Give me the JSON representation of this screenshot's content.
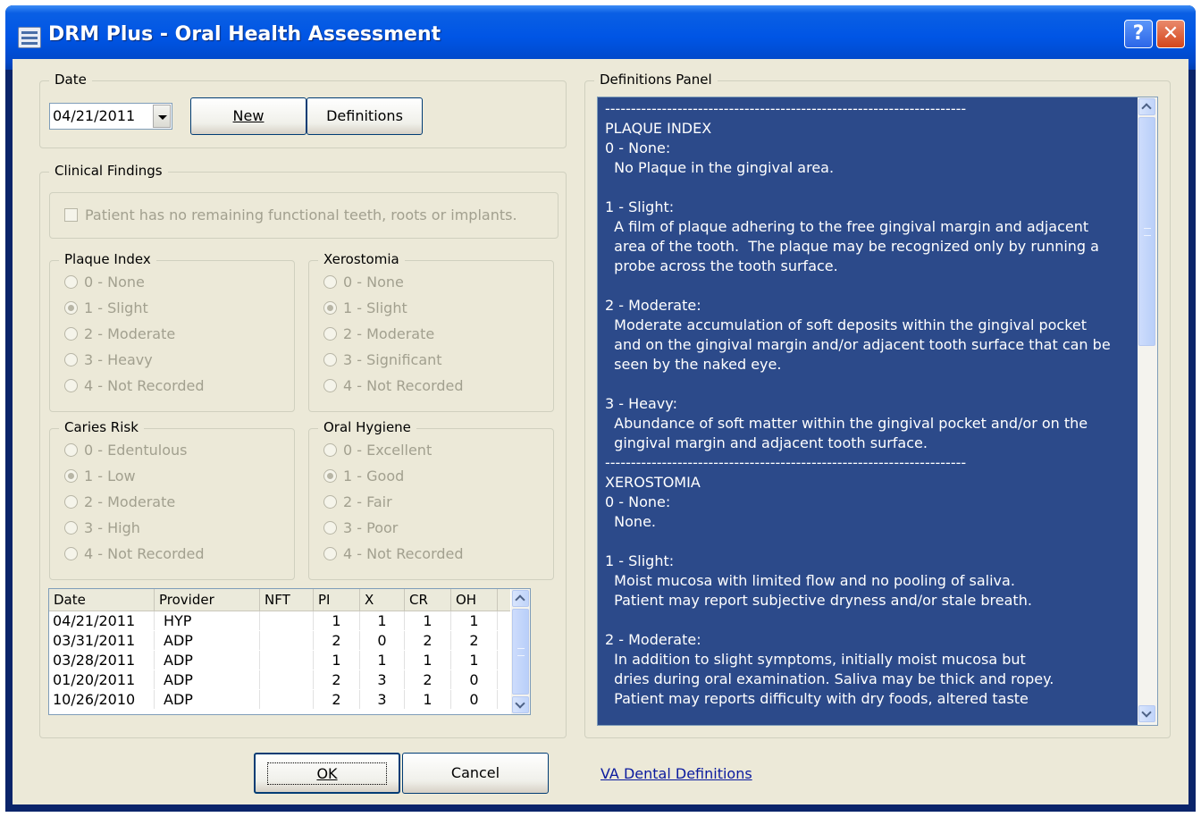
{
  "window": {
    "title": "DRM Plus - Oral Health Assessment",
    "help_label": "?",
    "close_label": "✕"
  },
  "date_group": {
    "legend": "Date",
    "date_value": "04/21/2011",
    "new_label": "New",
    "definitions_label": "Definitions"
  },
  "clinical": {
    "legend": "Clinical Findings",
    "no_teeth_label": "Patient has no remaining functional teeth, roots or implants.",
    "plaque": {
      "legend": "Plaque Index",
      "selected": 1,
      "options": [
        "0 - None",
        "1 - Slight",
        "2 - Moderate",
        "3 - Heavy",
        "4 - Not Recorded"
      ]
    },
    "xerostomia": {
      "legend": "Xerostomia",
      "selected": 1,
      "options": [
        "0 - None",
        "1 - Slight",
        "2 - Moderate",
        "3 - Significant",
        "4 - Not Recorded"
      ]
    },
    "caries": {
      "legend": "Caries Risk",
      "selected": 1,
      "options": [
        "0 - Edentulous",
        "1 - Low",
        "2 - Moderate",
        "3 - High",
        "4 - Not Recorded"
      ]
    },
    "hygiene": {
      "legend": "Oral Hygiene",
      "selected": 1,
      "options": [
        "0 - Excellent",
        "1 - Good",
        "2 - Fair",
        "3 - Poor",
        "4 - Not Recorded"
      ]
    }
  },
  "history": {
    "columns": [
      "Date",
      "Provider",
      "NFT",
      "PI",
      "X",
      "CR",
      "OH"
    ],
    "rows": [
      [
        "04/21/2011",
        "HYP",
        "",
        "1",
        "1",
        "1",
        "1"
      ],
      [
        "03/31/2011",
        "ADP",
        "",
        "2",
        "0",
        "2",
        "2"
      ],
      [
        "03/28/2011",
        "ADP",
        "",
        "1",
        "1",
        "1",
        "1"
      ],
      [
        "01/20/2011",
        "ADP",
        "",
        "2",
        "3",
        "2",
        "0"
      ],
      [
        "10/26/2010",
        "ADP",
        "",
        "2",
        "3",
        "1",
        "0"
      ]
    ]
  },
  "definitions": {
    "legend": "Definitions Panel",
    "lines": [
      "----------------------------------------------------------------------",
      "PLAQUE INDEX",
      "0 - None:",
      "  No Plaque in the gingival area.",
      "",
      "1 - Slight:",
      "  A film of plaque adhering to the free gingival margin and adjacent",
      "  area of the tooth.  The plaque may be recognized only by running a",
      "  probe across the tooth surface.",
      "",
      "2 - Moderate:",
      "  Moderate accumulation of soft deposits within the gingival pocket",
      "  and on the gingival margin and/or adjacent tooth surface that can be",
      "  seen by the naked eye.",
      "",
      "3 - Heavy:",
      "  Abundance of soft matter within the gingival pocket and/or on the",
      "  gingival margin and adjacent tooth surface.",
      "----------------------------------------------------------------------",
      "XEROSTOMIA",
      "0 - None:",
      "  None.",
      "",
      "1 - Slight:",
      "  Moist mucosa with limited flow and no pooling of saliva.",
      "  Patient may report subjective dryness and/or stale breath.",
      "",
      "2 - Moderate:",
      "  In addition to slight symptoms, initially moist mucosa but",
      "  dries during oral examination. Saliva may be thick and ropey.",
      "  Patient may reports difficulty with dry foods, altered taste"
    ]
  },
  "footer": {
    "ok_label": "OK",
    "cancel_label": "Cancel",
    "link_label": "VA Dental Definitions"
  },
  "colors": {
    "title_bar": "#0055e5",
    "dialog_bg": "#ece9d8",
    "definitions_bg": "#2c4a8a",
    "disabled_text": "#a2a08f"
  }
}
